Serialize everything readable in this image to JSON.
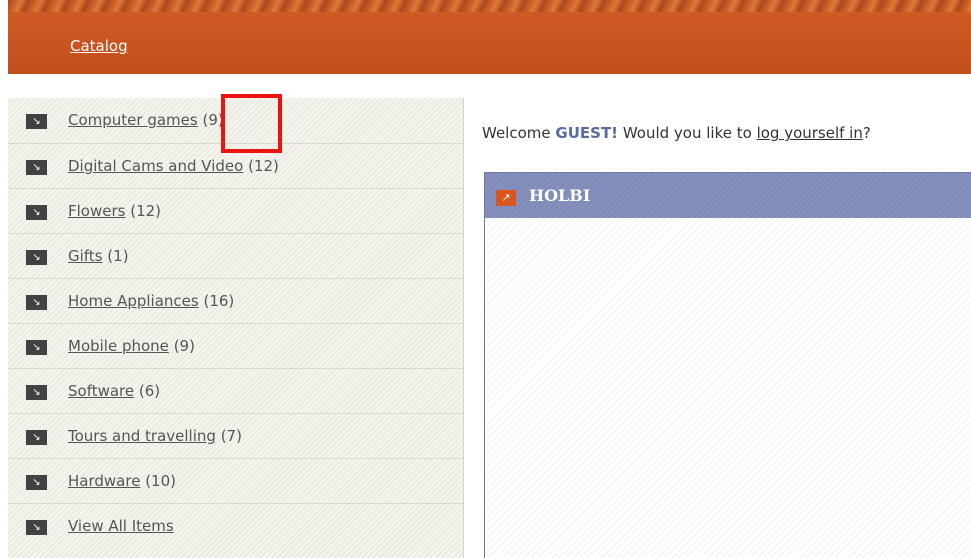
{
  "header": {
    "nav_link": "Catalog"
  },
  "sidebar": {
    "categories": [
      {
        "label": "Computer games",
        "count": "(9)"
      },
      {
        "label": "Digital Cams and Video",
        "count": "(12)"
      },
      {
        "label": "Flowers",
        "count": "(12)"
      },
      {
        "label": "Gifts",
        "count": "(1)"
      },
      {
        "label": "Home Appliances",
        "count": "(16)"
      },
      {
        "label": "Mobile phone",
        "count": "(9)"
      },
      {
        "label": "Software",
        "count": "(6)"
      },
      {
        "label": "Tours and travelling",
        "count": "(7)"
      },
      {
        "label": "Hardware",
        "count": "(10)"
      },
      {
        "label": "View All Items",
        "count": ""
      }
    ],
    "item_icon": "arrow-down-right-icon"
  },
  "welcome": {
    "prefix": "Welcome",
    "guest": "GUEST!",
    "question": "Would you like to",
    "login_link": "log yourself in",
    "suffix": "?"
  },
  "panel": {
    "title": "HOLBI",
    "icon": "arrow-up-right-icon"
  },
  "colors": {
    "header_bg": "#c9531e",
    "panel_header": "#7f8bb8",
    "highlight": "#ee1111",
    "guest": "#5b6aa0"
  }
}
